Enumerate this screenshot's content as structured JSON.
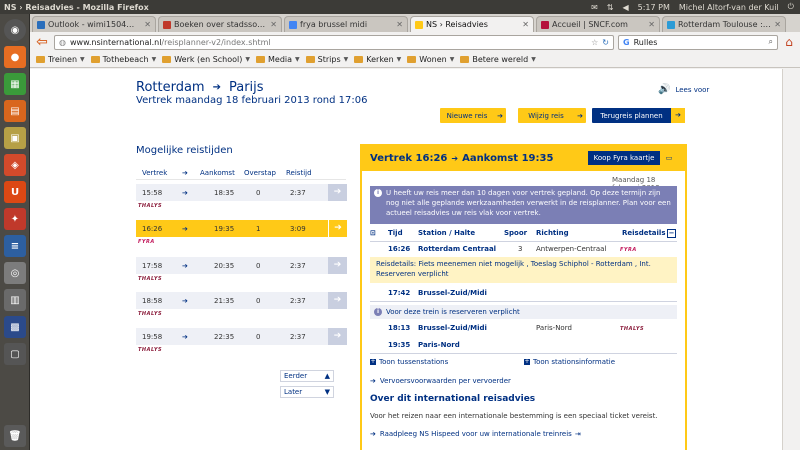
{
  "os": {
    "window_title": "NS › Reisadvies - Mozilla Firefox",
    "time": "5:17 PM",
    "user": "Michel Altorf-van der Kuil"
  },
  "browser": {
    "tabs": [
      {
        "label": "Outlook - wimi1504@...",
        "color": "#2a6ebb",
        "active": false
      },
      {
        "label": "Boeken over stadssoci...",
        "color": "#c0392b",
        "active": false
      },
      {
        "label": "frya brussel midi",
        "color": "#4285f4",
        "active": false
      },
      {
        "label": "NS › Reisadvies",
        "color": "#ffc917",
        "active": true
      },
      {
        "label": "Accueil | SNCF.com",
        "color": "#b5123c",
        "active": false
      },
      {
        "label": "Rotterdam Toulouse : ...",
        "color": "#2b9bd6",
        "active": false
      }
    ],
    "url_host": "www.nsinternational.nl",
    "url_path": "/reisplanner-v2/index.shtml",
    "search_value": "Rulles",
    "bookmarks": [
      "Treinen",
      "Tothebeach",
      "Werk (en School)",
      "Media",
      "Strips",
      "Kerken",
      "Wonen",
      "Betere wereld"
    ]
  },
  "page": {
    "from": "Rotterdam",
    "to": "Parijs",
    "subtitle": "Vertrek maandag 18 februari 2013 rond 17:06",
    "lees_voor": "Lees voor",
    "btn_nieuwe": "Nieuwe reis",
    "btn_wijzig": "Wijzig reis",
    "btn_terug": "Terugreis plannen",
    "section_title": "Mogelijke reistijden",
    "cols": {
      "vertrek": "Vertrek",
      "aankomst": "Aankomst",
      "overstap": "Overstap",
      "reistijd": "Reistijd"
    },
    "trips": [
      {
        "dep": "15:58",
        "arr": "18:35",
        "chg": "0",
        "dur": "2:37",
        "op": "THALYS",
        "selected": false
      },
      {
        "dep": "16:26",
        "arr": "19:35",
        "chg": "1",
        "dur": "3:09",
        "op": "FYRA",
        "selected": true
      },
      {
        "dep": "17:58",
        "arr": "20:35",
        "chg": "0",
        "dur": "2:37",
        "op": "THALYS",
        "selected": false
      },
      {
        "dep": "18:58",
        "arr": "21:35",
        "chg": "0",
        "dur": "2:37",
        "op": "THALYS",
        "selected": false
      },
      {
        "dep": "19:58",
        "arr": "22:35",
        "chg": "0",
        "dur": "2:37",
        "op": "THALYS",
        "selected": false
      }
    ],
    "earlier": "Eerder",
    "later": "Later"
  },
  "detail": {
    "dep_label": "Vertrek 16:26",
    "arr_label": "Aankomst 19:35",
    "koop": "Koop Fyra kaartje",
    "date": "Maandag 18 februari 2013",
    "info": "U heeft uw reis meer dan 10 dagen voor vertrek gepland. Op deze termijn zijn nog niet alle geplande werkzaamheden verwerkt in de reisplanner. Plan voor een actueel reisadvies uw reis vlak voor vertrek.",
    "headers": {
      "tijd": "Tijd",
      "station": "Station / Halte",
      "spoor": "Spoor",
      "richting": "Richting",
      "reisdetails": "Reisdetails"
    },
    "leg1": {
      "time": "16:26",
      "station": "Rotterdam Centraal",
      "platform": "3",
      "direction": "Antwerpen-Centraal",
      "op": "FYRA"
    },
    "leg1_notice": "Reisdetails: Fiets meenemen niet mogelijk , Toeslag Schiphol - Rotterdam , Int. Reserveren verplicht",
    "leg1_end": {
      "time": "17:42",
      "station": "Brussel-Zuid/Midi"
    },
    "reserve": "Voor deze trein is reserveren verplicht",
    "leg2": {
      "time": "18:13",
      "station": "Brussel-Zuid/Midi",
      "direction": "Paris-Nord",
      "op": "THALYS"
    },
    "leg2_end": {
      "time": "19:35",
      "station": "Paris-Nord"
    },
    "toon_tussen": "Toon tussenstations",
    "toon_info": "Toon stationsinformatie",
    "voorwaarden": "Vervoersvoorwaarden per vervoerder",
    "about_title": "Over dit international reisadvies",
    "about_text": "Voor het reizen naar een internationale bestemming is een speciaal ticket vereist.",
    "hispeed": "Raadpleeg NS Hispeed voor uw internationale treinreis"
  }
}
